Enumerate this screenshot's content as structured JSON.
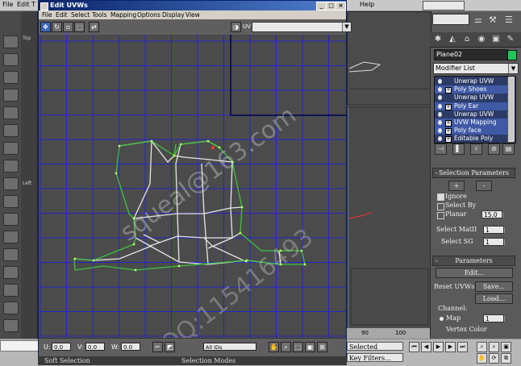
{
  "app_menu": {
    "file": "File",
    "edit": "Edit",
    "t": "T",
    "help": "Help"
  },
  "left_strip": {
    "label1": "Top",
    "label2": "Left"
  },
  "dialog": {
    "title": "Edit UVWs",
    "menu": [
      "File",
      "Edit",
      "Select",
      "Tools",
      "Mapping",
      "Options",
      "Display",
      "View"
    ],
    "map_selector": "UV",
    "bottom": {
      "u_label": "U:",
      "u_value": "0.0",
      "v_label": "V:",
      "v_value": "0.0",
      "w_label": "W:",
      "w_value": "0.0",
      "filter": "All IDs"
    },
    "status_left": "Soft Selection",
    "status_right": "Selection Modes"
  },
  "command_panel": {
    "object_name": "Plane02",
    "object_color": "#22c55a",
    "modifier_list": "Modifier List",
    "stack": [
      {
        "label": "Unwrap UVW",
        "expand": false,
        "selected": false
      },
      {
        "label": "Poly Shoes",
        "expand": true,
        "selected": true
      },
      {
        "label": "Unwrap UVW",
        "expand": false,
        "selected": false
      },
      {
        "label": "Poly Ear",
        "expand": true,
        "selected": true
      },
      {
        "label": "Unwrap UVW",
        "expand": false,
        "selected": false
      },
      {
        "label": "UVW Mapping",
        "expand": true,
        "selected": true
      },
      {
        "label": "Poly face",
        "expand": true,
        "selected": true
      },
      {
        "label": "Editable Poly",
        "expand": true,
        "selected": false
      }
    ],
    "selection_params": {
      "title": "Selection Parameters",
      "sign": "-",
      "plus": "+",
      "minus": "-",
      "ignore": "Ignore",
      "select_by": "Select By",
      "planar": "Planar",
      "planar_value": "15.0",
      "select_matid": "Select MatII",
      "matid_value": "1",
      "select_sg": "Select SG",
      "sg_value": "1"
    },
    "parameters": {
      "title": "Parameters",
      "sign": "-",
      "edit": "Edit...",
      "reset_uvws": "Reset UVWs",
      "save": "Save...",
      "load": "Load...",
      "channel": "Channel:",
      "map": "Map",
      "map_value": "1",
      "vertex_color": "Vertex Color"
    }
  },
  "viewport": {
    "timeline_90": "90",
    "timeline_100": "100"
  },
  "bottom_bar": {
    "selected": "Selected",
    "key_filters": "Key Filters..."
  },
  "watermark": {
    "line1": "squeal@163.com",
    "line2": "QQ:115416493"
  }
}
